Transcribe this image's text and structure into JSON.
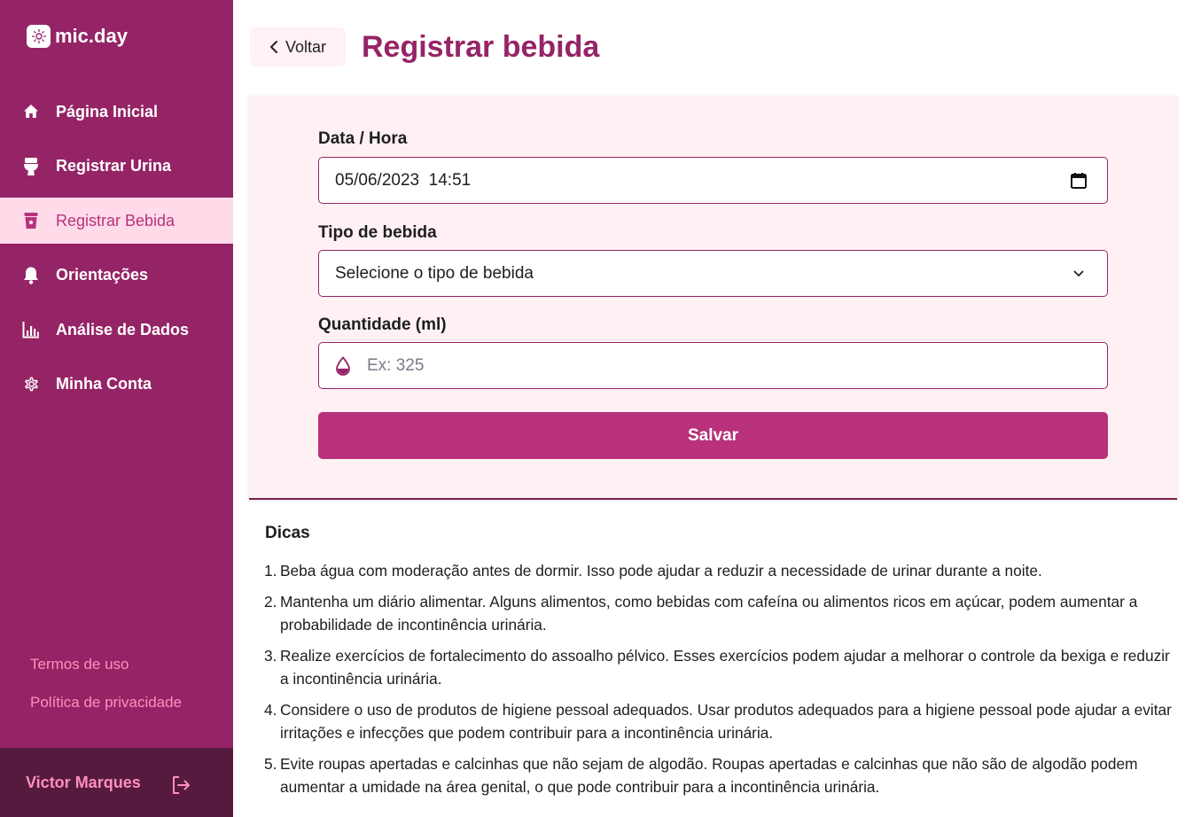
{
  "app": {
    "name": "mic.day"
  },
  "sidebar": {
    "items": [
      {
        "label": "Página Inicial",
        "icon": "home-icon"
      },
      {
        "label": "Registrar Urina",
        "icon": "toilet-icon"
      },
      {
        "label": "Registrar Bebida",
        "icon": "cup-icon",
        "active": true
      },
      {
        "label": "Orientações",
        "icon": "bell-icon"
      },
      {
        "label": "Análise de Dados",
        "icon": "bar-chart-icon"
      },
      {
        "label": "Minha Conta",
        "icon": "gear-icon"
      }
    ],
    "links": {
      "terms": "Termos de uso",
      "privacy": "Política de privacidade"
    },
    "user": {
      "name": "Victor Marques",
      "logout_icon": "logout-icon"
    }
  },
  "header": {
    "back_label": "Voltar",
    "title": "Registrar bebida"
  },
  "form": {
    "datetime": {
      "label": "Data / Hora",
      "value": "05/06/2023  14:51",
      "icon": "calendar-icon"
    },
    "drink_type": {
      "label": "Tipo de bebida",
      "value": "Selecione o tipo de bebida",
      "icon": "chevron-down-icon"
    },
    "quantity": {
      "label": "Quantidade (ml)",
      "placeholder": "Ex: 325",
      "icon": "droplet-icon"
    },
    "save_label": "Salvar"
  },
  "tips": {
    "title": "Dicas",
    "items": [
      {
        "num": "1.",
        "text": "Beba água com moderação antes de dormir. Isso pode ajudar a reduzir a necessidade de urinar durante a noite."
      },
      {
        "num": "2.",
        "text": "Mantenha um diário alimentar. Alguns alimentos, como bebidas com cafeína ou alimentos ricos em açúcar, podem aumentar a probabilidade de incontinência urinária."
      },
      {
        "num": "3.",
        "text": "Realize exercícios de fortalecimento do assoalho pélvico. Esses exercícios podem ajudar a melhorar o controle da bexiga e reduzir a incontinência urinária."
      },
      {
        "num": "4.",
        "text": "Considere o uso de produtos de higiene pessoal adequados. Usar produtos adequados para a higiene pessoal pode ajudar a evitar irritações e infecções que podem contribuir para a incontinência urinária."
      },
      {
        "num": "5.",
        "text": "Evite roupas apertadas e calcinhas que não sejam de algodão. Roupas apertadas e calcinhas que não são de algodão podem aumentar a umidade na área genital, o que pode contribuir para a incontinência urinária."
      }
    ]
  },
  "colors": {
    "sidebar": "#952466",
    "accent": "#b8317a",
    "active_bg": "#ffdbea",
    "card_bg": "#fff1f3",
    "user_bar": "#561a3e",
    "link": "#ff8fbf"
  }
}
